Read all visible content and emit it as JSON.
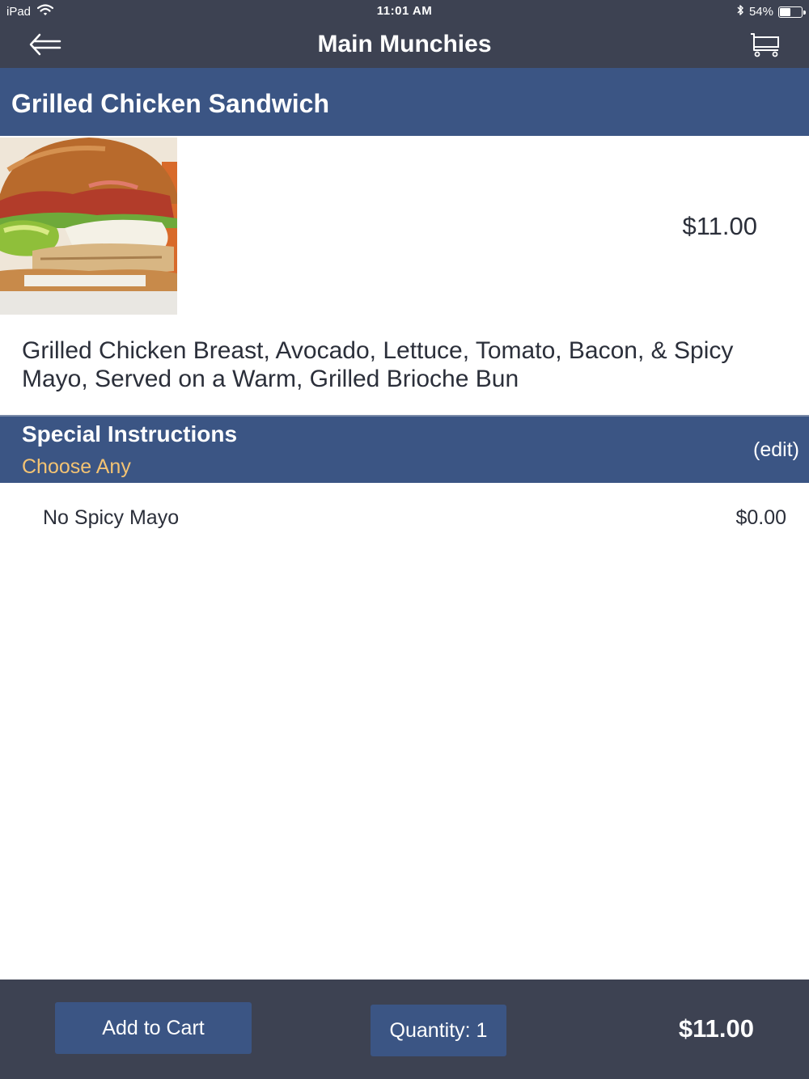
{
  "status_bar": {
    "device": "iPad",
    "time": "11:01 AM",
    "battery": "54%",
    "battery_level": 0.54,
    "icons": [
      "wifi-icon",
      "bluetooth-icon",
      "battery-icon"
    ]
  },
  "nav": {
    "title": "Main Munchies",
    "back_icon": "back-arrow-icon",
    "cart_icon": "cart-icon"
  },
  "item": {
    "name": "Grilled Chicken Sandwich",
    "price": "$11.00",
    "description": "Grilled Chicken Breast, Avocado, Lettuce, Tomato, Bacon, & Spicy Mayo, Served on a Warm, Grilled Brioche Bun"
  },
  "special_instructions": {
    "title": "Special Instructions",
    "subtitle": "Choose Any",
    "edit_label": "(edit)",
    "options": [
      {
        "label": "No Spicy Mayo",
        "price": "$0.00"
      }
    ]
  },
  "footer": {
    "add_to_cart_label": "Add to Cart",
    "quantity_label": "Quantity: 1",
    "total": "$11.00"
  },
  "colors": {
    "nav_bg": "#3d4252",
    "header_bg": "#3b5584",
    "accent_text": "#f3c373",
    "body_text": "#2b2f3a"
  }
}
